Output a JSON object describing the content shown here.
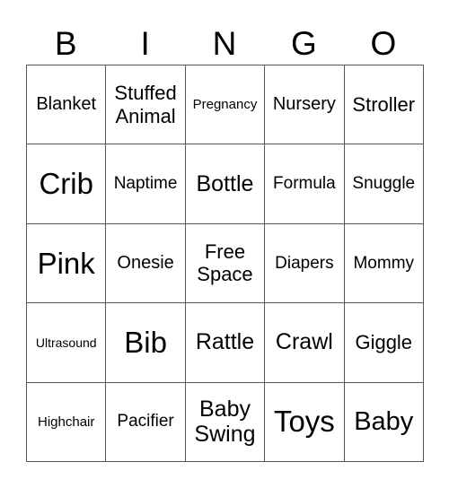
{
  "header": [
    "B",
    "I",
    "N",
    "G",
    "O"
  ],
  "cells": [
    [
      "Blanket",
      "Stuffed Animal",
      "Pregnancy",
      "Nursery",
      "Stroller"
    ],
    [
      "Crib",
      "Naptime",
      "Bottle",
      "Formula",
      "Snuggle"
    ],
    [
      "Pink",
      "Onesie",
      "Free Space",
      "Diapers",
      "Mommy"
    ],
    [
      "Ultrasound",
      "Bib",
      "Rattle",
      "Crawl",
      "Giggle"
    ],
    [
      "Highchair",
      "Pacifier",
      "Baby Swing",
      "Toys",
      "Baby"
    ]
  ]
}
